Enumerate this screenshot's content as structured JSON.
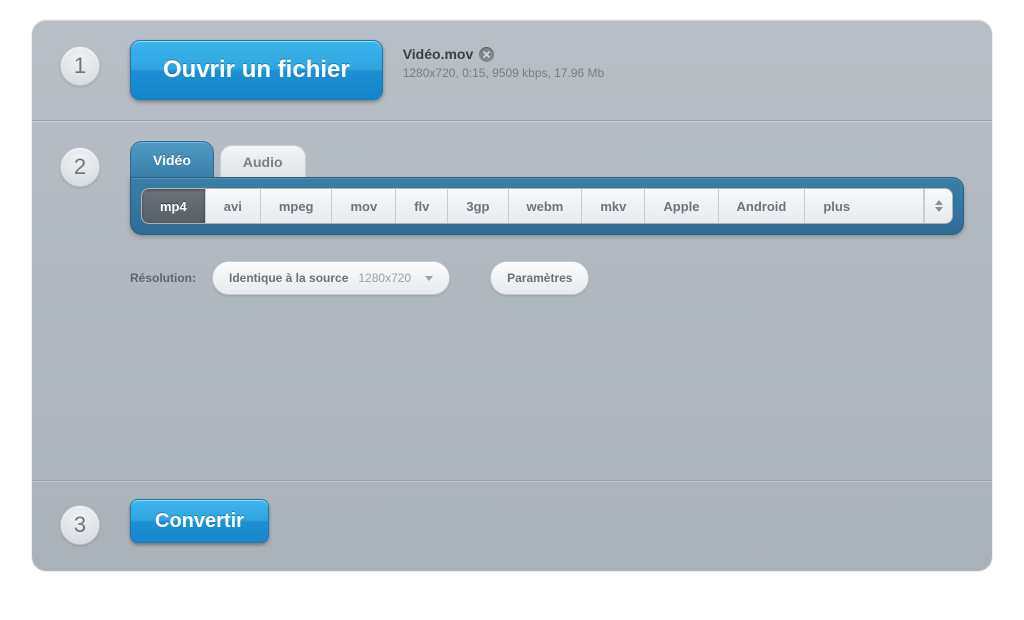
{
  "step1": {
    "number": "1",
    "open_button_label": "Ouvrir un fichier",
    "file_name": "Vidéo.mov",
    "file_details": "1280x720, 0:15, 9509 kbps, 17.96 Mb"
  },
  "step2": {
    "number": "2",
    "tab_video_label": "Vidéo",
    "tab_audio_label": "Audio",
    "formats": [
      "mp4",
      "avi",
      "mpeg",
      "mov",
      "flv",
      "3gp",
      "webm",
      "mkv",
      "Apple",
      "Android",
      "plus"
    ],
    "selected_format_index": 0,
    "resolution_label": "Résolution:",
    "resolution_value": "Identique à la source",
    "resolution_dims": "1280x720",
    "settings_button_label": "Paramètres"
  },
  "step3": {
    "number": "3",
    "convert_button_label": "Convertir"
  }
}
